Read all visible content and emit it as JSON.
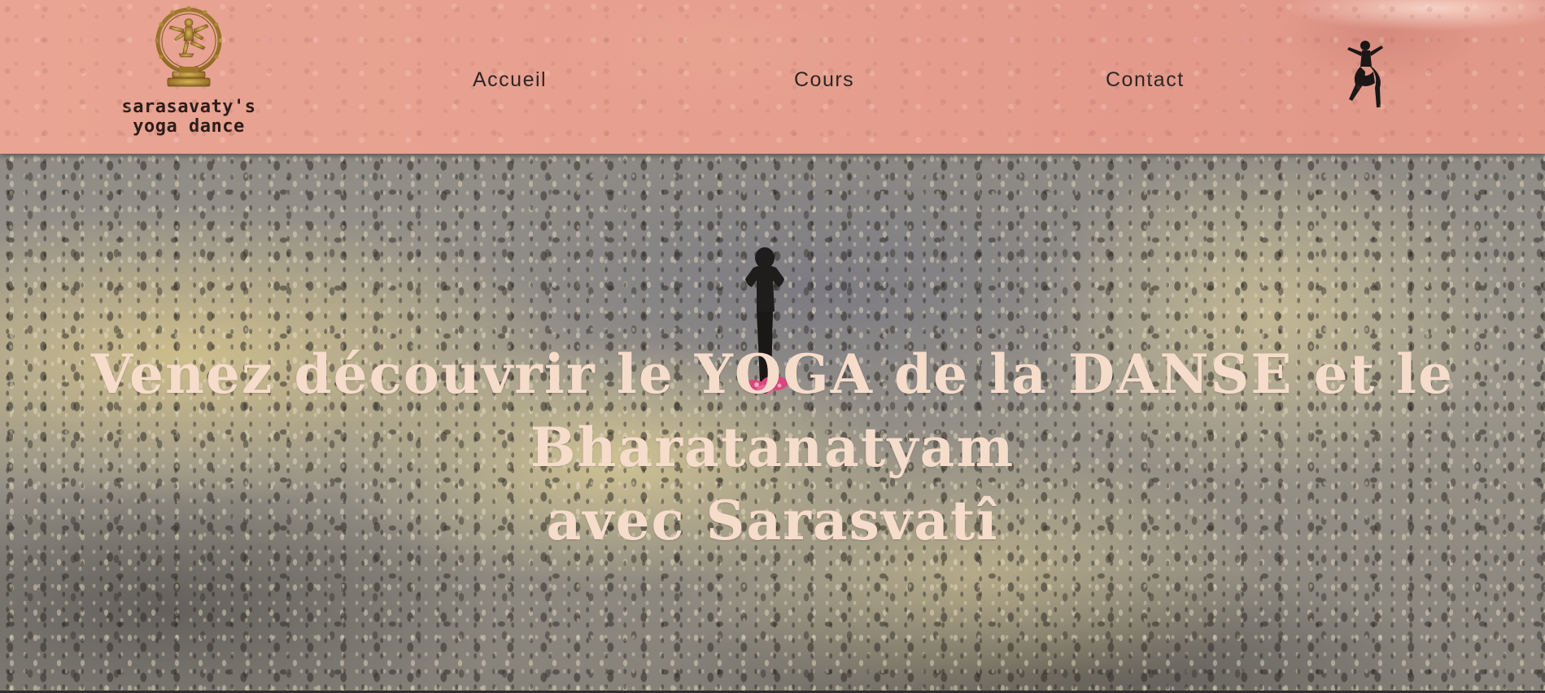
{
  "header": {
    "logo_line1": "sarasavaty's",
    "logo_line2": "yoga dance",
    "nav": {
      "home": "Accueil",
      "courses": "Cours",
      "contact": "Contact"
    },
    "icons": {
      "logo_emblem": "nataraja-dancer-emblem",
      "right_icon": "dancer-silhouette-icon"
    }
  },
  "hero": {
    "headline_line1": "Venez découvrir le YOGA de la DANSE et le Bharatanatyam",
    "headline_line2": "avec Sarasvatî"
  },
  "colors": {
    "header_bg": "#e7a08f",
    "nav_text": "#2e2424",
    "headline_text": "#f6dccb",
    "logo_gold": "#b28a3a",
    "flower_pink": "#d8477e"
  }
}
